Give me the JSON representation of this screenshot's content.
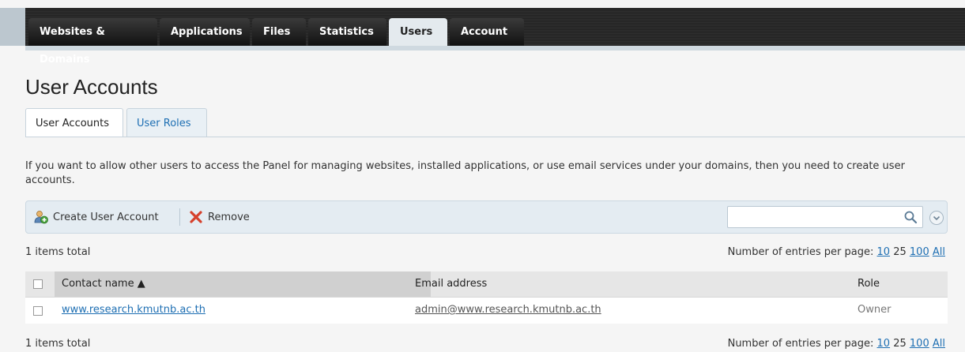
{
  "nav": {
    "tabs": [
      {
        "label": "Websites & Domains"
      },
      {
        "label": "Applications"
      },
      {
        "label": "Files"
      },
      {
        "label": "Statistics"
      },
      {
        "label": "Users",
        "active": true
      },
      {
        "label": "Account"
      }
    ]
  },
  "page": {
    "title": "User Accounts",
    "subtabs": [
      "User Accounts",
      "User Roles"
    ],
    "description": "If you want to allow other users to access the Panel for managing websites, installed applications, or use email services under your domains, then you need to create user accounts."
  },
  "toolbar": {
    "create_label": "Create User Account",
    "remove_label": "Remove",
    "search_placeholder": ""
  },
  "listing": {
    "total_text": "1 items total",
    "per_page_label": "Number of entries per page:",
    "per_page_options": [
      "10",
      "25",
      "100",
      "All"
    ],
    "per_page_current": "25"
  },
  "table": {
    "columns": [
      "Contact name ▲",
      "Email address",
      "Role"
    ],
    "rows": [
      {
        "name": "www.research.kmutnb.ac.th",
        "email": "admin@www.research.kmutnb.ac.th",
        "role": "Owner"
      }
    ]
  },
  "colors": {
    "accent": "#1e6fb3",
    "nav_dark": "#222222",
    "toolbar_bg": "#e4ecf2"
  }
}
